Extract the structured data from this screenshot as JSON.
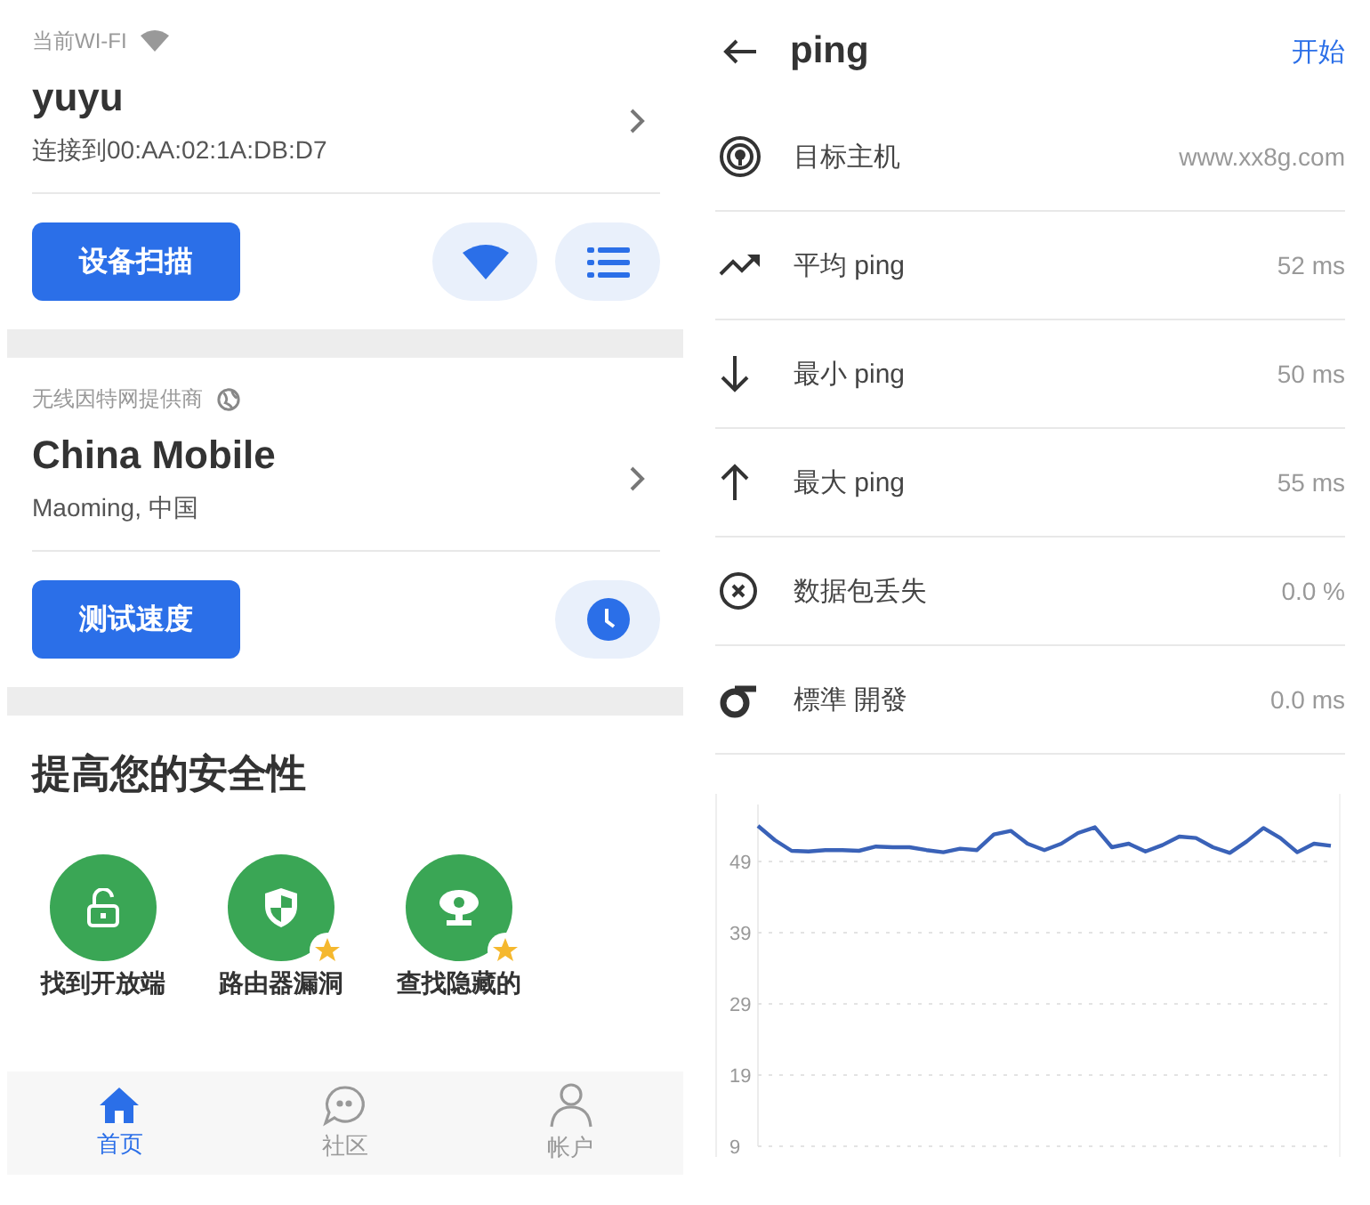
{
  "wifi_screen": {
    "wifi_card": {
      "label": "当前WI-FI",
      "name": "yuyu",
      "connection": "连接到00:AA:02:1A:DB:D7",
      "button": "设备扫描"
    },
    "isp_card": {
      "label": "无线因特网提供商",
      "name": "China Mobile",
      "location": "Maoming, 中国",
      "button": "测试速度"
    },
    "security": {
      "title": "提高您的安全性",
      "items": [
        {
          "kind": "lock",
          "label": "找到开放端",
          "premium": false
        },
        {
          "kind": "shield",
          "label": "路由器漏洞",
          "premium": true
        },
        {
          "kind": "camera",
          "label": "查找隐藏的",
          "premium": true
        }
      ]
    },
    "bottom_nav": [
      {
        "kind": "home",
        "label": "首页",
        "selected": true
      },
      {
        "kind": "community",
        "label": "社区",
        "selected": false
      },
      {
        "kind": "account",
        "label": "帐户",
        "selected": false
      }
    ]
  },
  "ping_screen": {
    "title": "ping",
    "action": "开始",
    "rows": [
      {
        "kind": "target",
        "label": "目标主机",
        "value": "www.xx8g.com"
      },
      {
        "kind": "average",
        "label": "平均 ping",
        "value": "52 ms"
      },
      {
        "kind": "min",
        "label": "最小 ping",
        "value": "50 ms"
      },
      {
        "kind": "max",
        "label": "最大 ping",
        "value": "55 ms"
      },
      {
        "kind": "loss",
        "label": "数据包丢失",
        "value": "0.0 %"
      },
      {
        "kind": "sigma",
        "label": "標準 開發",
        "value": "0.0 ms"
      }
    ],
    "chart_data": {
      "type": "line",
      "ylim": [
        9,
        57
      ],
      "yticks": [
        49,
        39,
        29,
        19,
        9
      ],
      "grid": true,
      "series": [
        {
          "color": "#3a62b8",
          "values": [
            54,
            52,
            50.5,
            50.4,
            50.6,
            50.6,
            50.5,
            51.1,
            51,
            51,
            50.6,
            50.3,
            50.8,
            50.6,
            52.8,
            53.3,
            51.5,
            50.6,
            51.5,
            53,
            53.8,
            51,
            51.5,
            50.4,
            51.3,
            52.5,
            52.3,
            51,
            50.2,
            51.8,
            53.7,
            52.3,
            50.3,
            51.5,
            51.2
          ]
        }
      ]
    }
  }
}
